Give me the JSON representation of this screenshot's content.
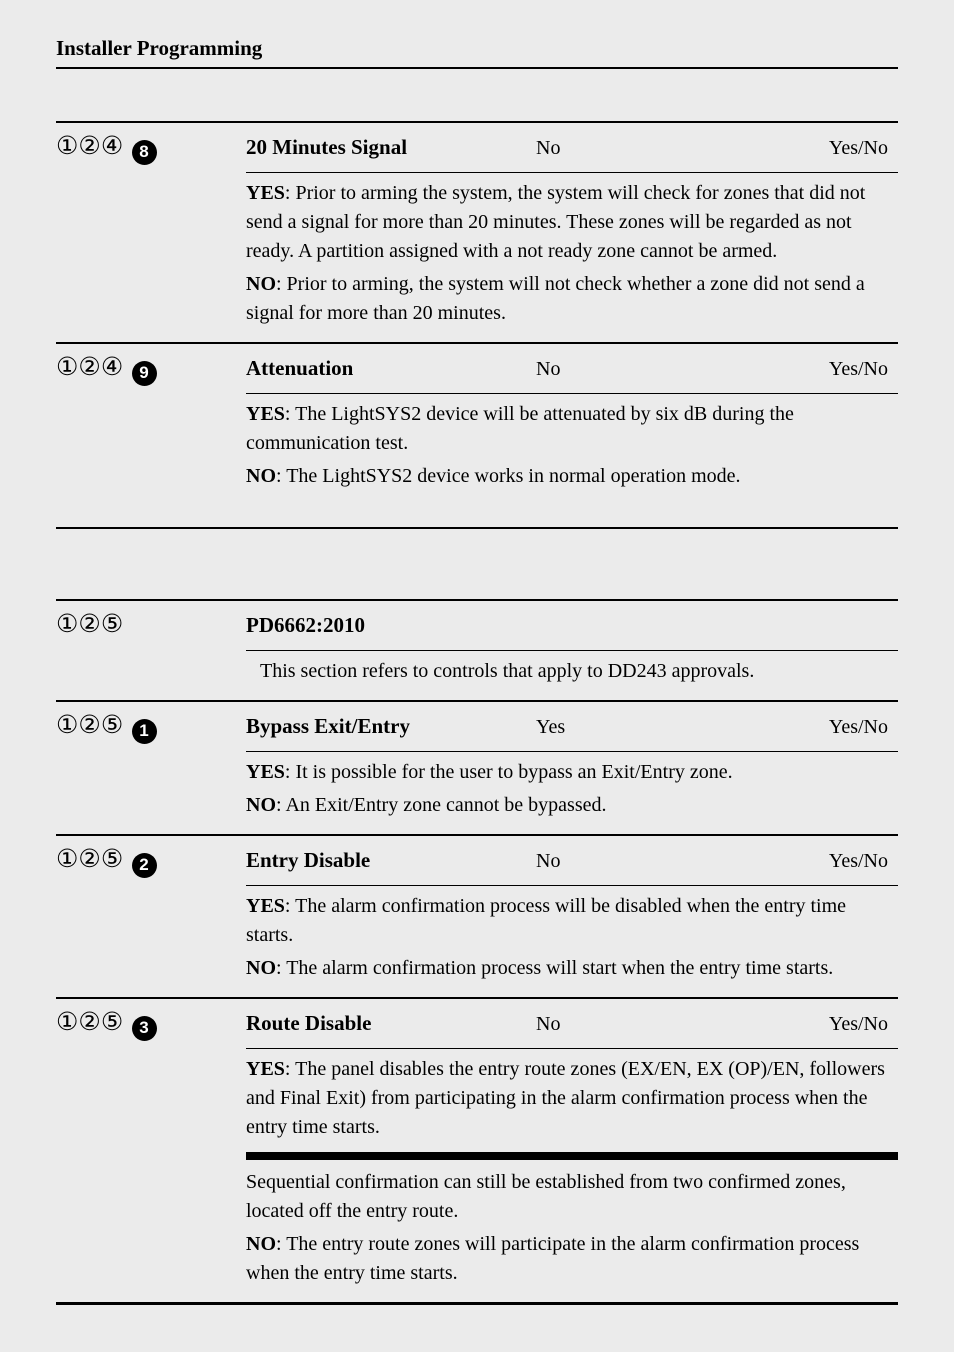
{
  "page_title": "Installer Programming",
  "group1": {
    "item8": {
      "code_nums": "①②④",
      "code_bold": "8",
      "name": "20 Minutes Signal",
      "default": "No",
      "range": "Yes/No",
      "yes_label": "YES",
      "yes_text": ": Prior to arming the system, the system will check for zones that did not send a signal for more than 20 minutes. These zones will be regarded as not ready. A partition assigned with a not ready zone cannot be armed.",
      "no_label": "NO",
      "no_text": ": Prior to arming, the system will not check whether a zone did not send a signal for more than 20 minutes."
    },
    "item9": {
      "code_nums": "①②④",
      "code_bold": "9",
      "name": "Attenuation",
      "default": "No",
      "range": "Yes/No",
      "yes_label": "YES",
      "yes_text": ": The LightSYS2 device will be attenuated by six dB during the communication test.",
      "no_label": "NO",
      "no_text": ": The LightSYS2 device works in normal operation mode."
    }
  },
  "group2": {
    "header": {
      "code_nums": "①②⑤",
      "name": "PD6662:2010",
      "intro": "This section refers to controls that apply to DD243 approvals."
    },
    "item1": {
      "code_nums": "①②⑤",
      "code_bold": "1",
      "name": "Bypass Exit/Entry",
      "default": "Yes",
      "range": "Yes/No",
      "yes_label": "YES",
      "yes_text": ": It is possible for the user to bypass an Exit/Entry zone.",
      "no_label": "NO",
      "no_text": ": An Exit/Entry zone cannot be bypassed."
    },
    "item2": {
      "code_nums": "①②⑤",
      "code_bold": "2",
      "name": "Entry Disable",
      "default": "No",
      "range": "Yes/No",
      "yes_label": "YES",
      "yes_text": ": The alarm confirmation process will be disabled when the entry time starts.",
      "no_label": "NO",
      "no_text": ": The alarm confirmation process will start when the entry time starts."
    },
    "item3": {
      "code_nums": "①②⑤",
      "code_bold": "3",
      "name": "Route Disable",
      "default": "No",
      "range": "Yes/No",
      "yes_label": "YES",
      "yes_text": ": The panel disables the entry route zones (EX/EN, EX (OP)/EN, followers and Final Exit) from participating in the alarm confirmation process when the entry time starts.",
      "note_text": "Sequential confirmation can still be established from two confirmed zones, located off the entry route.",
      "no_label": "NO",
      "no_text": ": The entry route zones will participate in the alarm confirmation process when the entry time starts."
    }
  }
}
